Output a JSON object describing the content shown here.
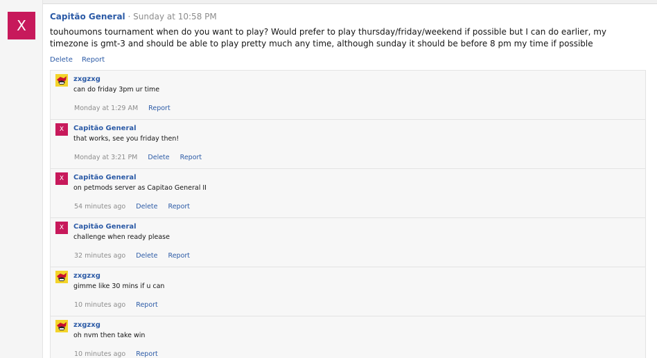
{
  "post": {
    "avatar_letter": "X",
    "author": "Capitão General",
    "separator": "·",
    "time": "Sunday at 10:58 PM",
    "body": "touhoumons tournament when do you want to play? Would prefer to play thursday/friday/weekend if possible but I can do earlier, my timezone is gmt-3 and should be able to play pretty much any time, although sunday it should be before 8 pm my time if possible",
    "delete_label": "Delete",
    "report_label": "Report"
  },
  "comments": [
    {
      "avatar": "character-avatar",
      "author": "zxgzxg",
      "text": "can do friday 3pm ur time",
      "time": "Monday at 1:29 AM",
      "delete_label": "",
      "report_label": "Report"
    },
    {
      "avatar_letter": "X",
      "author": "Capitão General",
      "text": "that works, see you friday then!",
      "time": "Monday at 3:21 PM",
      "delete_label": "Delete",
      "report_label": "Report"
    },
    {
      "avatar_letter": "X",
      "author": "Capitão General",
      "text": "on petmods server as Capitao General II",
      "time": "54 minutes ago",
      "delete_label": "Delete",
      "report_label": "Report"
    },
    {
      "avatar_letter": "X",
      "author": "Capitão General",
      "text": "challenge when ready please",
      "time": "32 minutes ago",
      "delete_label": "Delete",
      "report_label": "Report"
    },
    {
      "avatar": "character-avatar",
      "author": "zxgzxg",
      "text": "gimme like 30 mins if u can",
      "time": "10 minutes ago",
      "delete_label": "",
      "report_label": "Report"
    },
    {
      "avatar": "character-avatar",
      "author": "zxgzxg",
      "text": "oh nvm then take win",
      "time": "10 minutes ago",
      "delete_label": "",
      "report_label": "Report"
    }
  ],
  "colors": {
    "accent": "#2b5aa6",
    "avatar_bg": "#c7195b",
    "muted": "#8c8c8c"
  }
}
